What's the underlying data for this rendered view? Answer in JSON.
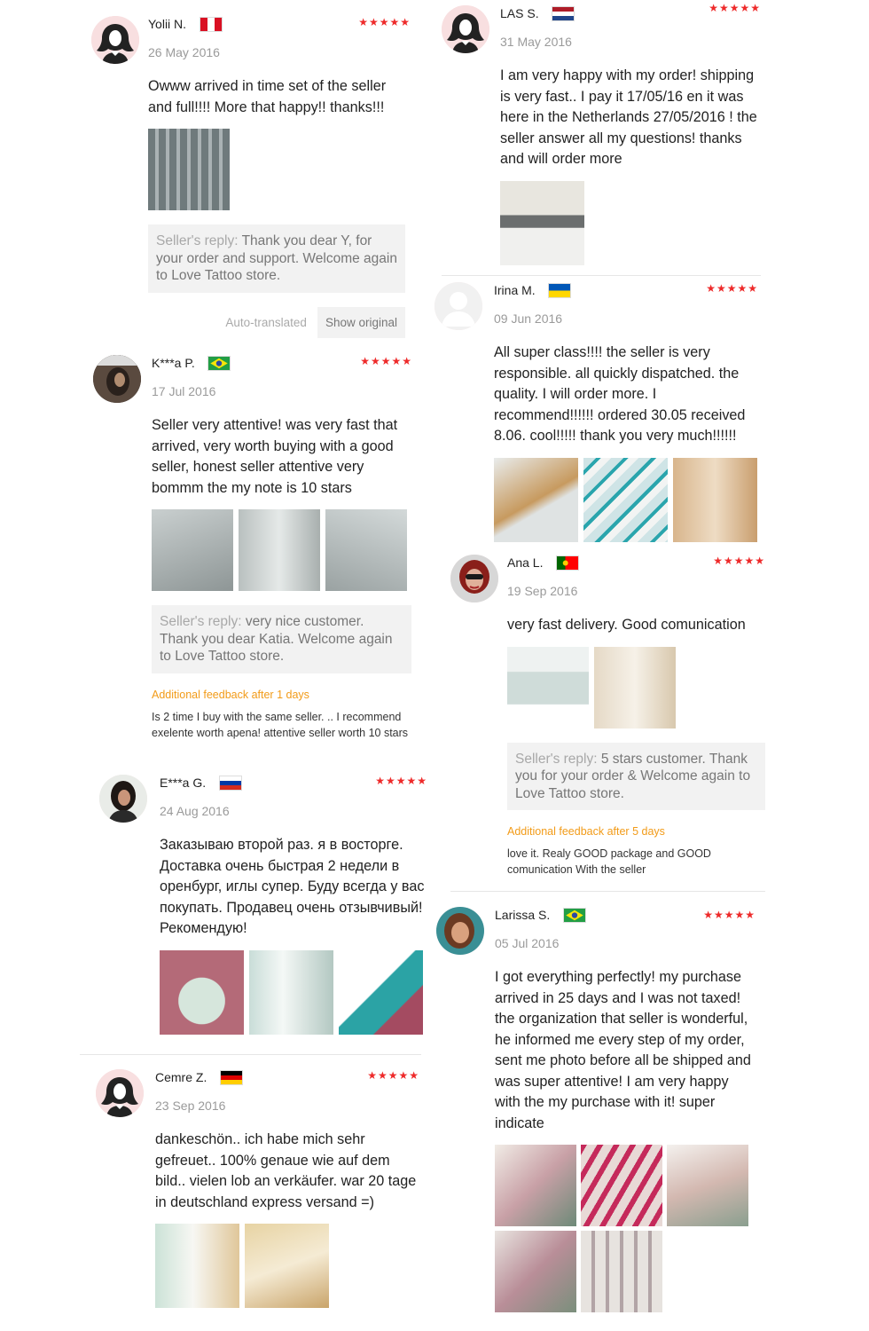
{
  "colors": {
    "star": "#ee2a2a",
    "additional_label": "#f29b18",
    "muted": "#9a9a9a"
  },
  "reviews": {
    "yolii": {
      "name": "Yolii N.",
      "flag": "Peru",
      "stars": "★★★★★",
      "date": "26 May 2016",
      "text": "Owww arrived in time set of the seller and full!!!! More that happy!! thanks!!!",
      "reply_label": "Seller's reply:",
      "reply_text": " Thank you dear Y, for your order and support. Welcome again to Love Tattoo store.",
      "auto_translated": "Auto-translated",
      "show_original": "Show original"
    },
    "kaa": {
      "name": "K***a P.",
      "flag": "Brazil",
      "stars": "★★★★★",
      "date": "17 Jul 2016",
      "text": "Seller very attentive! was very fast that arrived, very worth buying with a good seller, honest seller attentive very bommm the my note is 10 stars",
      "reply_label": "Seller's reply:",
      "reply_text": " very nice customer. Thank you dear Katia. Welcome again to Love Tattoo store.",
      "additional_label": "Additional feedback after 1 days",
      "additional_text": "Is 2 time I buy with the same seller. .. I recommend exelente worth apena! attentive seller worth 10 stars"
    },
    "eaa": {
      "name": "E***a G.",
      "flag": "Russia",
      "stars": "★★★★★",
      "date": "24 Aug 2016",
      "text": "Заказываю второй раз. я в восторге. Доставка очень быстрая 2 недели в оренбург, иглы супер. Буду всегда у вас покупать. Продавец очень отзывчивый! Рекомендую!"
    },
    "cemre": {
      "name": "Cemre Z.",
      "flag": "Germany",
      "stars": "★★★★★",
      "date": "23 Sep 2016",
      "text": "dankeschön.. ich habe mich sehr gefreuet.. 100% genaue wie auf dem bild.. vielen lob an verkäufer. war 20 tage in deutschland express versand =)"
    },
    "las": {
      "name": "LAS S.",
      "flag": "Netherlands",
      "stars": "★★★★★",
      "date": "31 May 2016",
      "text": "I am very happy with my order! shipping is very fast.. I pay it 17/05/16 en it was here in the Netherlands 27/05/2016 ! the seller answer all my questions! thanks and will order more"
    },
    "irina": {
      "name": "Irina M.",
      "flag": "Ukraine",
      "stars": "★★★★★",
      "date": "09 Jun 2016",
      "text": "All super class!!!! the seller is very responsible. all quickly dispatched. the quality. I will order more. I recommend!!!!!! ordered 30.05 received 8.06. cool!!!!! thank you very much!!!!!!"
    },
    "ana": {
      "name": "Ana L.",
      "flag": "Portugal",
      "stars": "★★★★★",
      "date": "19 Sep 2016",
      "text": "very fast delivery.  Good comunication",
      "reply_label": "Seller's reply:",
      "reply_text": " 5 stars customer. Thank you for your order & Welcome again to Love Tattoo store.",
      "additional_label": "Additional feedback after 5 days",
      "additional_text": "love it. Realy GOOD package and GOOD comunication With the seller"
    },
    "larissa": {
      "name": "Larissa S.",
      "flag": "Brazil",
      "stars": "★★★★★",
      "date": "05 Jul 2016",
      "text": "I got everything perfectly! my purchase arrived in 25 days and I was not taxed! the organization that seller is wonderful, he informed me every step of my order, sent me photo before all be shipped and was super attentive! I am very happy with the my purchase with it! super indicate"
    }
  }
}
